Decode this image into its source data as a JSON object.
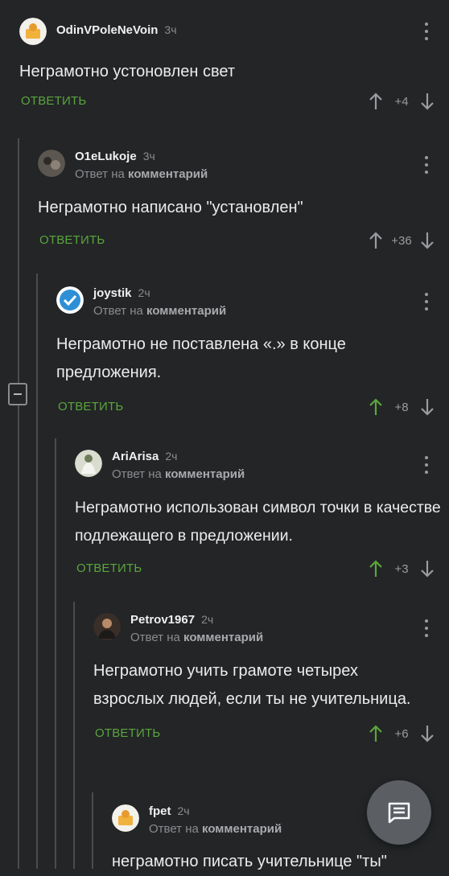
{
  "comments": [
    {
      "user": "OdinVPoleNeVoin",
      "time": "3ч",
      "reply_prefix": "",
      "reply_link": "",
      "text": "Неграмотно устоновлен свет",
      "reply_label": "ОТВЕТИТЬ",
      "score": "+4",
      "vote": "none"
    },
    {
      "user": "O1eLukoje",
      "time": "3ч",
      "reply_prefix": "Ответ на",
      "reply_link": "комментарий",
      "text": "Неграмотно написано \"установлен\"",
      "reply_label": "ОТВЕТИТЬ",
      "score": "+36",
      "vote": "none"
    },
    {
      "user": "joystik",
      "time": "2ч",
      "reply_prefix": "Ответ на",
      "reply_link": "комментарий",
      "text": "Неграмотно не поставлена «.» в конце предложения.",
      "reply_label": "ОТВЕТИТЬ",
      "score": "+8",
      "vote": "up"
    },
    {
      "user": "AriArisa",
      "time": "2ч",
      "reply_prefix": "Ответ на",
      "reply_link": "комментарий",
      "text": "Неграмотно использован символ точки в качестве подлежащего в предложении.",
      "reply_label": "ОТВЕТИТЬ",
      "score": "+3",
      "vote": "up"
    },
    {
      "user": "Petrov1967",
      "time": "2ч",
      "reply_prefix": "Ответ на",
      "reply_link": "комментарий",
      "text": "Неграмотно учить грамоте четырех взрослых людей, если ты не учительница.",
      "reply_label": "ОТВЕТИТЬ",
      "score": "+6",
      "vote": "up"
    },
    {
      "user": "fpet",
      "time": "2ч",
      "reply_prefix": "Ответ на",
      "reply_link": "комментарий",
      "text": "неграмотно писать учительнице \"ты\"",
      "reply_label": "",
      "score": "",
      "vote": "none"
    }
  ],
  "icons": {
    "more": "more-vertical-icon",
    "upvote": "arrow-up-icon",
    "downvote": "arrow-down-icon",
    "collapse": "collapse-minus-icon",
    "fab": "message-icon"
  },
  "colors": {
    "background": "#232527",
    "accent": "#5aa63c",
    "muted": "#8a8c8f",
    "fab": "#5b5e63"
  }
}
